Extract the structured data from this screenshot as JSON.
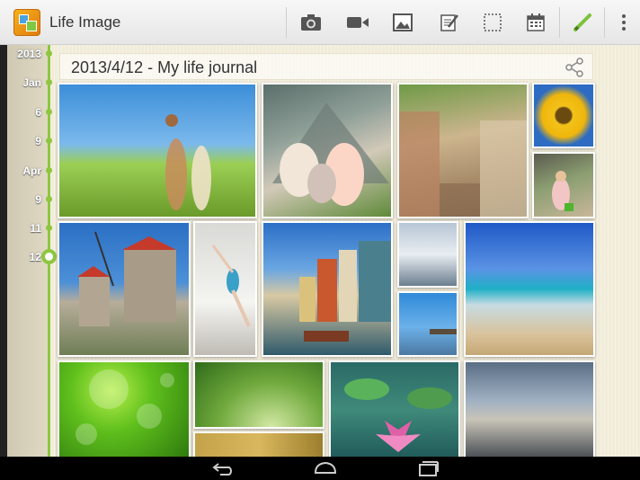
{
  "app": {
    "title": "Life Image",
    "icon": "app-photo-icon"
  },
  "toolbar": {
    "actions": [
      {
        "name": "camera-icon"
      },
      {
        "name": "video-camera-icon"
      },
      {
        "name": "image-icon"
      },
      {
        "name": "edit-note-icon"
      },
      {
        "name": "select-frame-icon"
      },
      {
        "name": "calendar-icon"
      },
      {
        "name": "pen-icon"
      },
      {
        "name": "overflow-menu-icon"
      }
    ]
  },
  "timeline": {
    "labels": [
      "2013",
      "Jan",
      "6",
      "9",
      "Apr",
      "9",
      "11",
      "12"
    ],
    "current": "12",
    "accent": "#8ec73f"
  },
  "journal": {
    "title": "2013/4/12 - My life journal",
    "share_icon": "share-icon"
  },
  "photos": [
    {
      "name": "family-field-photo"
    },
    {
      "name": "family-tent-photo"
    },
    {
      "name": "village-street-photo"
    },
    {
      "name": "sunflower-photo"
    },
    {
      "name": "child-garden-photo"
    },
    {
      "name": "windmills-photo"
    },
    {
      "name": "dancer-photo"
    },
    {
      "name": "harbor-photo"
    },
    {
      "name": "snow-forest-photo"
    },
    {
      "name": "pier-photo"
    },
    {
      "name": "beach-waves-photo"
    },
    {
      "name": "water-drops-leaf-photo"
    },
    {
      "name": "agave-plant-photo"
    },
    {
      "name": "autumn-leaves-photo"
    },
    {
      "name": "lotus-flower-photo"
    },
    {
      "name": "rocky-shore-photo"
    }
  ],
  "navbar": {
    "buttons": [
      "back-icon",
      "home-icon",
      "recents-icon"
    ]
  }
}
